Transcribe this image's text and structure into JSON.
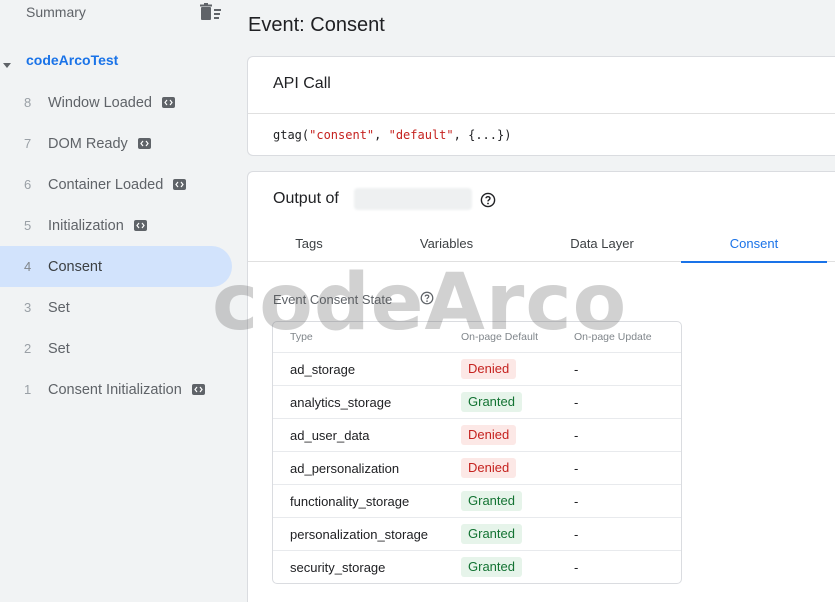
{
  "sidebar": {
    "summary_label": "Summary",
    "container_name": "codeArcoTest",
    "events": [
      {
        "number": "8",
        "label": "Window Loaded",
        "has_code_icon": true,
        "active": false
      },
      {
        "number": "7",
        "label": "DOM Ready",
        "has_code_icon": true,
        "active": false
      },
      {
        "number": "6",
        "label": "Container Loaded",
        "has_code_icon": true,
        "active": false
      },
      {
        "number": "5",
        "label": "Initialization",
        "has_code_icon": true,
        "active": false
      },
      {
        "number": "4",
        "label": "Consent",
        "has_code_icon": false,
        "active": true
      },
      {
        "number": "3",
        "label": "Set",
        "has_code_icon": false,
        "active": false
      },
      {
        "number": "2",
        "label": "Set",
        "has_code_icon": false,
        "active": false
      },
      {
        "number": "1",
        "label": "Consent Initialization",
        "has_code_icon": true,
        "active": false
      }
    ]
  },
  "main": {
    "page_title": "Event: Consent",
    "api_call": {
      "heading": "API Call",
      "code_prefix": "gtag(",
      "code_arg1": "\"consent\"",
      "code_sep": ", ",
      "code_arg2": "\"default\"",
      "code_suffix": ", {...})"
    },
    "output": {
      "title": "Output of",
      "tabs": [
        {
          "label": "Tags",
          "active": false
        },
        {
          "label": "Variables",
          "active": false
        },
        {
          "label": "Data Layer",
          "active": false
        },
        {
          "label": "Consent",
          "active": true
        }
      ],
      "state_heading": "Event Consent State",
      "table": {
        "headers": [
          "Type",
          "On-page Default",
          "On-page Update"
        ],
        "rows": [
          {
            "type": "ad_storage",
            "default": "Denied",
            "update": "-"
          },
          {
            "type": "analytics_storage",
            "default": "Granted",
            "update": "-"
          },
          {
            "type": "ad_user_data",
            "default": "Denied",
            "update": "-"
          },
          {
            "type": "ad_personalization",
            "default": "Denied",
            "update": "-"
          },
          {
            "type": "functionality_storage",
            "default": "Granted",
            "update": "-"
          },
          {
            "type": "personalization_storage",
            "default": "Granted",
            "update": "-"
          },
          {
            "type": "security_storage",
            "default": "Granted",
            "update": "-"
          }
        ]
      }
    }
  },
  "watermark": "codeArco",
  "colors": {
    "accent": "#1a73e8",
    "active_item_bg": "#d2e3fc",
    "denied_bg": "#fce8e6",
    "denied_text": "#c5221f",
    "granted_bg": "#e6f4ea",
    "granted_text": "#137333"
  },
  "icons": {
    "summary": "delete-list-icon",
    "container": "caret-down-icon",
    "event": "code-icon",
    "help": "help-circle-icon"
  }
}
